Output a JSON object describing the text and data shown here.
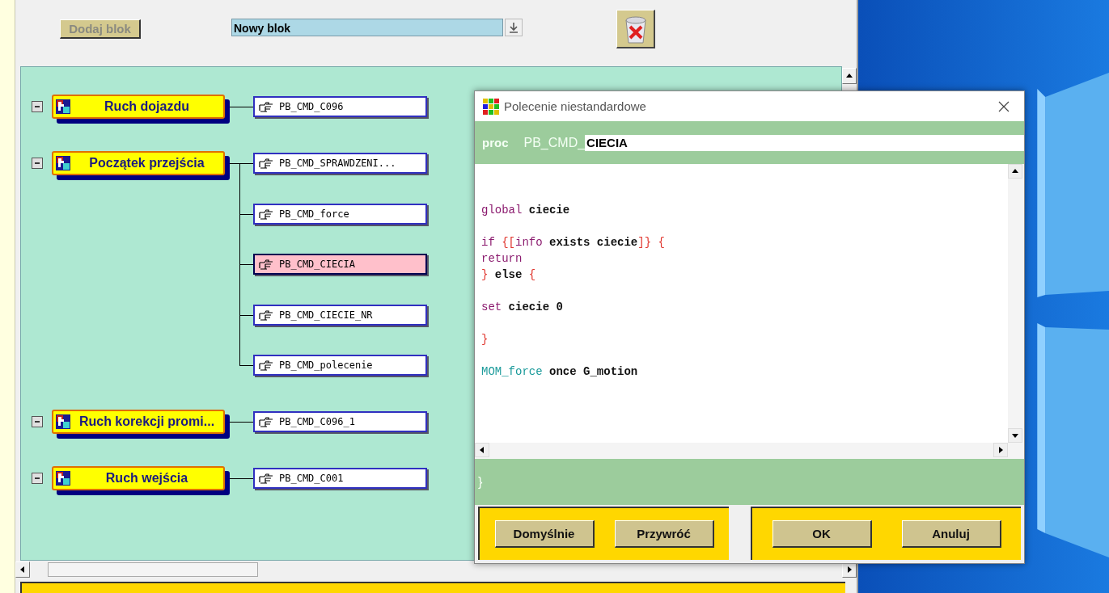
{
  "toolbar": {
    "add_button": {
      "label": "Dodaj blok",
      "disabled": true
    },
    "block_select": {
      "value": "Nowy blok"
    }
  },
  "blocks": [
    {
      "label": "Ruch dojazdu",
      "expanded": true,
      "commands": [
        {
          "label": "PB_CMD_C096",
          "selected": false
        }
      ]
    },
    {
      "label": "Początek przejścia",
      "expanded": true,
      "commands": [
        {
          "label": "PB_CMD_SPRAWDZENI...",
          "selected": false
        },
        {
          "label": "PB_CMD_force",
          "selected": false
        },
        {
          "label": "PB_CMD_CIECIA",
          "selected": true
        },
        {
          "label": "PB_CMD_CIECIE_NR",
          "selected": false
        },
        {
          "label": "PB_CMD_polecenie",
          "selected": false
        }
      ]
    },
    {
      "label": "Ruch korekcji promi...",
      "expanded": true,
      "commands": [
        {
          "label": "PB_CMD_C096_1",
          "selected": false
        }
      ]
    },
    {
      "label": "Ruch wejścia",
      "expanded": true,
      "commands": [
        {
          "label": "PB_CMD_C001",
          "selected": false
        }
      ]
    }
  ],
  "dialog": {
    "title": "Polecenie niestandardowe",
    "proc_keyword": "proc",
    "name_prefix": "PB_CMD_",
    "name_value": "CIECIA",
    "code_paragraphs": [
      [
        [
          {
            "kind": "keyword",
            "text": "global"
          },
          {
            "kind": "plain",
            "text": " ciecie"
          }
        ]
      ],
      [
        [
          {
            "kind": "keyword",
            "text": "if"
          },
          {
            "kind": "brace",
            "text": " {["
          },
          {
            "kind": "keyword",
            "text": "info"
          },
          {
            "kind": "plain",
            "text": " exists ciecie"
          },
          {
            "kind": "brace",
            "text": "]} {"
          }
        ],
        [
          {
            "kind": "keyword",
            "text": "return"
          }
        ],
        [
          {
            "kind": "brace",
            "text": "}"
          },
          {
            "kind": "plain",
            "text": " else "
          },
          {
            "kind": "brace",
            "text": "{"
          }
        ]
      ],
      [
        [
          {
            "kind": "keyword",
            "text": "set"
          },
          {
            "kind": "plain",
            "text": " ciecie 0"
          }
        ]
      ],
      [
        [
          {
            "kind": "brace",
            "text": "}"
          }
        ]
      ],
      [
        [
          {
            "kind": "command",
            "text": "MOM_force"
          },
          {
            "kind": "plain",
            "text": " once G_motion"
          }
        ]
      ]
    ],
    "closing": "}",
    "left_buttons": [
      "Domyślnie",
      "Przywróć"
    ],
    "right_buttons": [
      "OK",
      "Anuluj"
    ]
  }
}
